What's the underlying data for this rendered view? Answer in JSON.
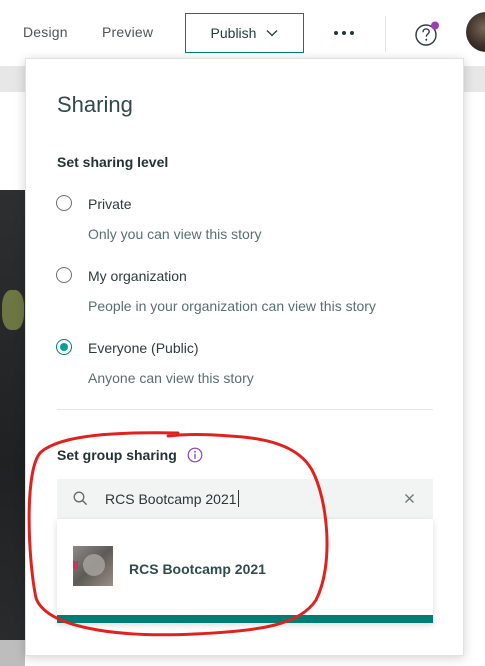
{
  "header": {
    "design_label": "Design",
    "preview_label": "Preview",
    "publish_label": "Publish"
  },
  "sharing": {
    "title": "Sharing",
    "level_heading": "Set sharing level",
    "options": [
      {
        "label": "Private",
        "description": "Only you can view this story",
        "selected": false
      },
      {
        "label": "My organization",
        "description": "People in your organization can view this story",
        "selected": false
      },
      {
        "label": "Everyone (Public)",
        "description": "Anyone can view this story",
        "selected": true
      }
    ],
    "group_heading": "Set group sharing",
    "search_value": "RCS Bootcamp 2021",
    "results": [
      {
        "label": "RCS Bootcamp 2021"
      }
    ]
  },
  "colors": {
    "accent": "#007d74",
    "radio_selected": "#00a0a0",
    "notification_dot": "#9b3fb5",
    "annotation": "#e0221f"
  },
  "icons": {
    "publish_chevron": "chevron-down-icon",
    "more": "more-icon",
    "help": "help-icon",
    "info": "info-icon",
    "search": "search-icon",
    "clear": "clear-icon"
  }
}
